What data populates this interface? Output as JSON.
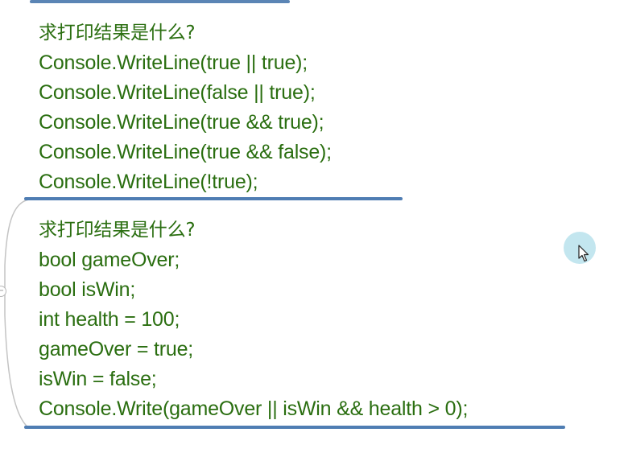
{
  "colors": {
    "text": "#2a6e10",
    "underline": "#4f7db3",
    "branch": "#c4c4c4",
    "cursor_halo": "#b9e2ec"
  },
  "node1": {
    "lines": [
      "求打印结果是什么?",
      "Console.WriteLine(true || true);",
      "Console.WriteLine(false || true);",
      "Console.WriteLine(true && true);",
      "Console.WriteLine(true && false);",
      "Console.WriteLine(!true);"
    ]
  },
  "node2": {
    "lines": [
      "求打印结果是什么?",
      "bool gameOver;",
      "bool isWin;",
      "int health = 100;",
      "gameOver = true;",
      "isWin = false;",
      "Console.Write(gameOver || isWin && health > 0);"
    ]
  },
  "toggle": {
    "symbol": "−"
  },
  "icons": [
    "collapse-toggle-icon",
    "mouse-cursor-icon"
  ]
}
